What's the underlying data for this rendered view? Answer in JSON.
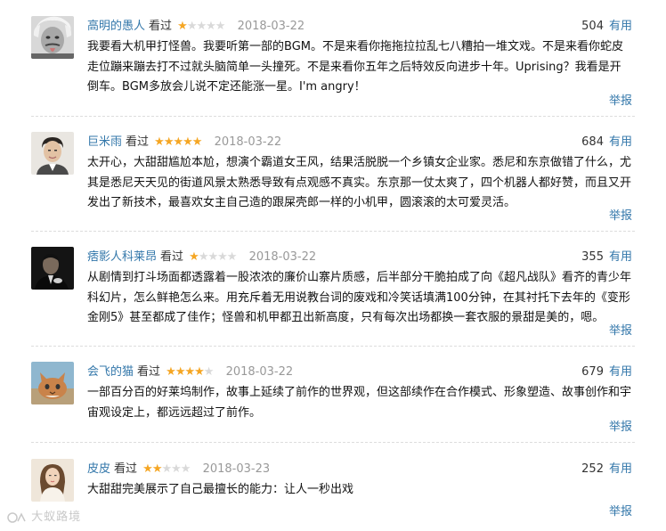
{
  "reviews": [
    {
      "user": "高明的愚人",
      "status": "看过",
      "rating": 1,
      "date": "2018-03-22",
      "votes": "504",
      "useful_label": "有用",
      "content": "我要看大机甲打怪兽。我要听第一部的BGM。不是来看你拖拖拉拉乱七八糟拍一堆文戏。不是来看你蛇皮走位蹦来蹦去打不过就头脑简单一头撞死。不是来看你五年之后特效反向进步十年。Uprising？我看是开倒车。BGM多放会儿说不定还能涨一星。I'm angry！",
      "report_label": "举报"
    },
    {
      "user": "巨米雨",
      "status": "看过",
      "rating": 5,
      "date": "2018-03-22",
      "votes": "684",
      "useful_label": "有用",
      "content": "太开心，大甜甜尴尬本尬，想演个霸道女王风，结果活脱脱一个乡镇女企业家。悉尼和东京做错了什么，尤其是悉尼天天见的街道风景太熟悉导致有点观感不真实。东京那一仗太爽了，四个机器人都好赞，而且又开发出了新技术，最喜欢女主自己造的跟屎壳郎一样的小机甲，圆滚滚的太可爱灵活。",
      "report_label": "举报"
    },
    {
      "user": "痞影人科莱昂",
      "status": "看过",
      "rating": 1,
      "date": "2018-03-22",
      "votes": "355",
      "useful_label": "有用",
      "content": "从剧情到打斗场面都透露着一股浓浓的廉价山寨片质感，后半部分干脆拍成了向《超凡战队》看齐的青少年科幻片，怎么鲜艳怎么来。用充斥着无用说教台词的废戏和冷笑话填满100分钟，在其衬托下去年的《变形金刚5》甚至都成了佳作；怪兽和机甲都丑出新高度，只有每次出场都换一套衣服的景甜是美的，嗯。",
      "report_label": "举报"
    },
    {
      "user": "会飞的猫",
      "status": "看过",
      "rating": 4,
      "date": "2018-03-22",
      "votes": "679",
      "useful_label": "有用",
      "content": "一部百分百的好莱坞制作，故事上延续了前作的世界观，但这部续作在合作模式、形象塑造、故事创作和宇宙观设定上，都远远超过了前作。",
      "report_label": "举报"
    },
    {
      "user": "皮皮",
      "status": "看过",
      "rating": 2,
      "date": "2018-03-23",
      "votes": "252",
      "useful_label": "有用",
      "content": "大甜甜完美展示了自己最擅长的能力：让人一秒出戏",
      "report_label": "举报"
    }
  ],
  "watermark": "大蚁路境"
}
